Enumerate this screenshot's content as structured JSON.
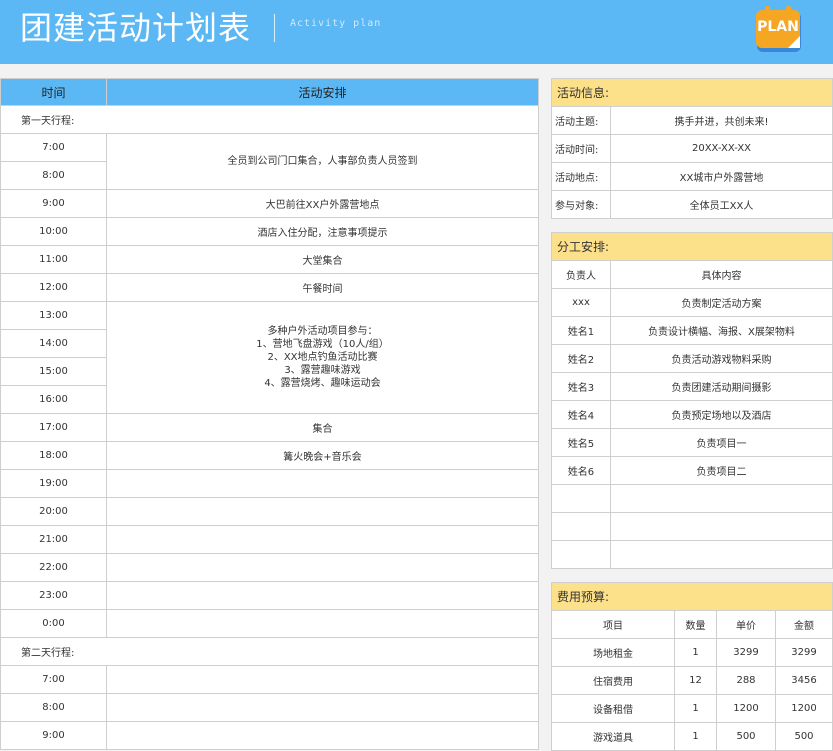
{
  "header": {
    "title": "团建活动计划表",
    "subtitle": "Activity plan",
    "plan_badge": "PLAN",
    "icon": "plan-calendar-icon"
  },
  "schedule": {
    "col_time": "时间",
    "col_activity": "活动安排",
    "day1_label": "第一天行程:",
    "day1": [
      {
        "time": "7:00",
        "activity": "全员到公司门口集合，人事部负责人员签到"
      },
      {
        "time": "8:00"
      },
      {
        "time": "9:00",
        "activity": "大巴前往XX户外露营地点"
      },
      {
        "time": "10:00",
        "activity": "酒店入住分配，注意事项提示"
      },
      {
        "time": "11:00",
        "activity": "大堂集合"
      },
      {
        "time": "12:00",
        "activity": "午餐时间"
      },
      {
        "time": "13:00",
        "activity_lines": [
          "多种户外活动项目参与：",
          "1、营地飞盘游戏（10人/组）",
          "2、XX地点钓鱼活动比赛",
          "3、露营趣味游戏",
          "4、露营烧烤、趣味运动会"
        ]
      },
      {
        "time": "14:00"
      },
      {
        "time": "15:00"
      },
      {
        "time": "16:00"
      },
      {
        "time": "17:00",
        "activity": "集合"
      },
      {
        "time": "18:00",
        "activity": "篝火晚会+音乐会"
      },
      {
        "time": "19:00",
        "activity": ""
      },
      {
        "time": "20:00",
        "activity": ""
      },
      {
        "time": "21:00",
        "activity": ""
      },
      {
        "time": "22:00",
        "activity": ""
      },
      {
        "time": "23:00",
        "activity": ""
      },
      {
        "time": "0:00",
        "activity": ""
      }
    ],
    "day2_label": "第二天行程:",
    "day2": [
      {
        "time": "7:00",
        "activity": ""
      },
      {
        "time": "8:00",
        "activity": ""
      },
      {
        "time": "9:00",
        "activity": ""
      }
    ]
  },
  "info": {
    "title": "活动信息:",
    "rows": [
      {
        "label": "活动主题:",
        "value": "携手并进，共创未来!"
      },
      {
        "label": "活动时间:",
        "value": "20XX-XX-XX"
      },
      {
        "label": "活动地点:",
        "value": "XX城市户外露营地"
      },
      {
        "label": "参与对象:",
        "value": "全体员工XX人"
      }
    ]
  },
  "division": {
    "title": "分工安排:",
    "col_person": "负责人",
    "col_content": "具体内容",
    "rows": [
      {
        "person": "xxx",
        "content": "负责制定活动方案"
      },
      {
        "person": "姓名1",
        "content": "负责设计横幅、海报、X展架物料"
      },
      {
        "person": "姓名2",
        "content": "负责活动游戏物料采购"
      },
      {
        "person": "姓名3",
        "content": "负责团建活动期间摄影"
      },
      {
        "person": "姓名4",
        "content": "负责预定场地以及酒店"
      },
      {
        "person": "姓名5",
        "content": "负责项目一"
      },
      {
        "person": "姓名6",
        "content": "负责项目二"
      },
      {
        "person": "",
        "content": ""
      },
      {
        "person": "",
        "content": ""
      },
      {
        "person": "",
        "content": ""
      }
    ]
  },
  "budget": {
    "title": "费用预算:",
    "col_item": "项目",
    "col_qty": "数量",
    "col_price": "单价",
    "col_amount": "金额",
    "rows": [
      {
        "item": "场地租金",
        "qty": "1",
        "price": "3299",
        "amount": "3299"
      },
      {
        "item": "住宿费用",
        "qty": "12",
        "price": "288",
        "amount": "3456"
      },
      {
        "item": "设备租借",
        "qty": "1",
        "price": "1200",
        "amount": "1200"
      },
      {
        "item": "游戏道具",
        "qty": "1",
        "price": "500",
        "amount": "500"
      }
    ]
  },
  "colors": {
    "header_blue": "#5bb8f4",
    "section_yellow": "#fde08a",
    "badge_orange": "#f5a623"
  }
}
